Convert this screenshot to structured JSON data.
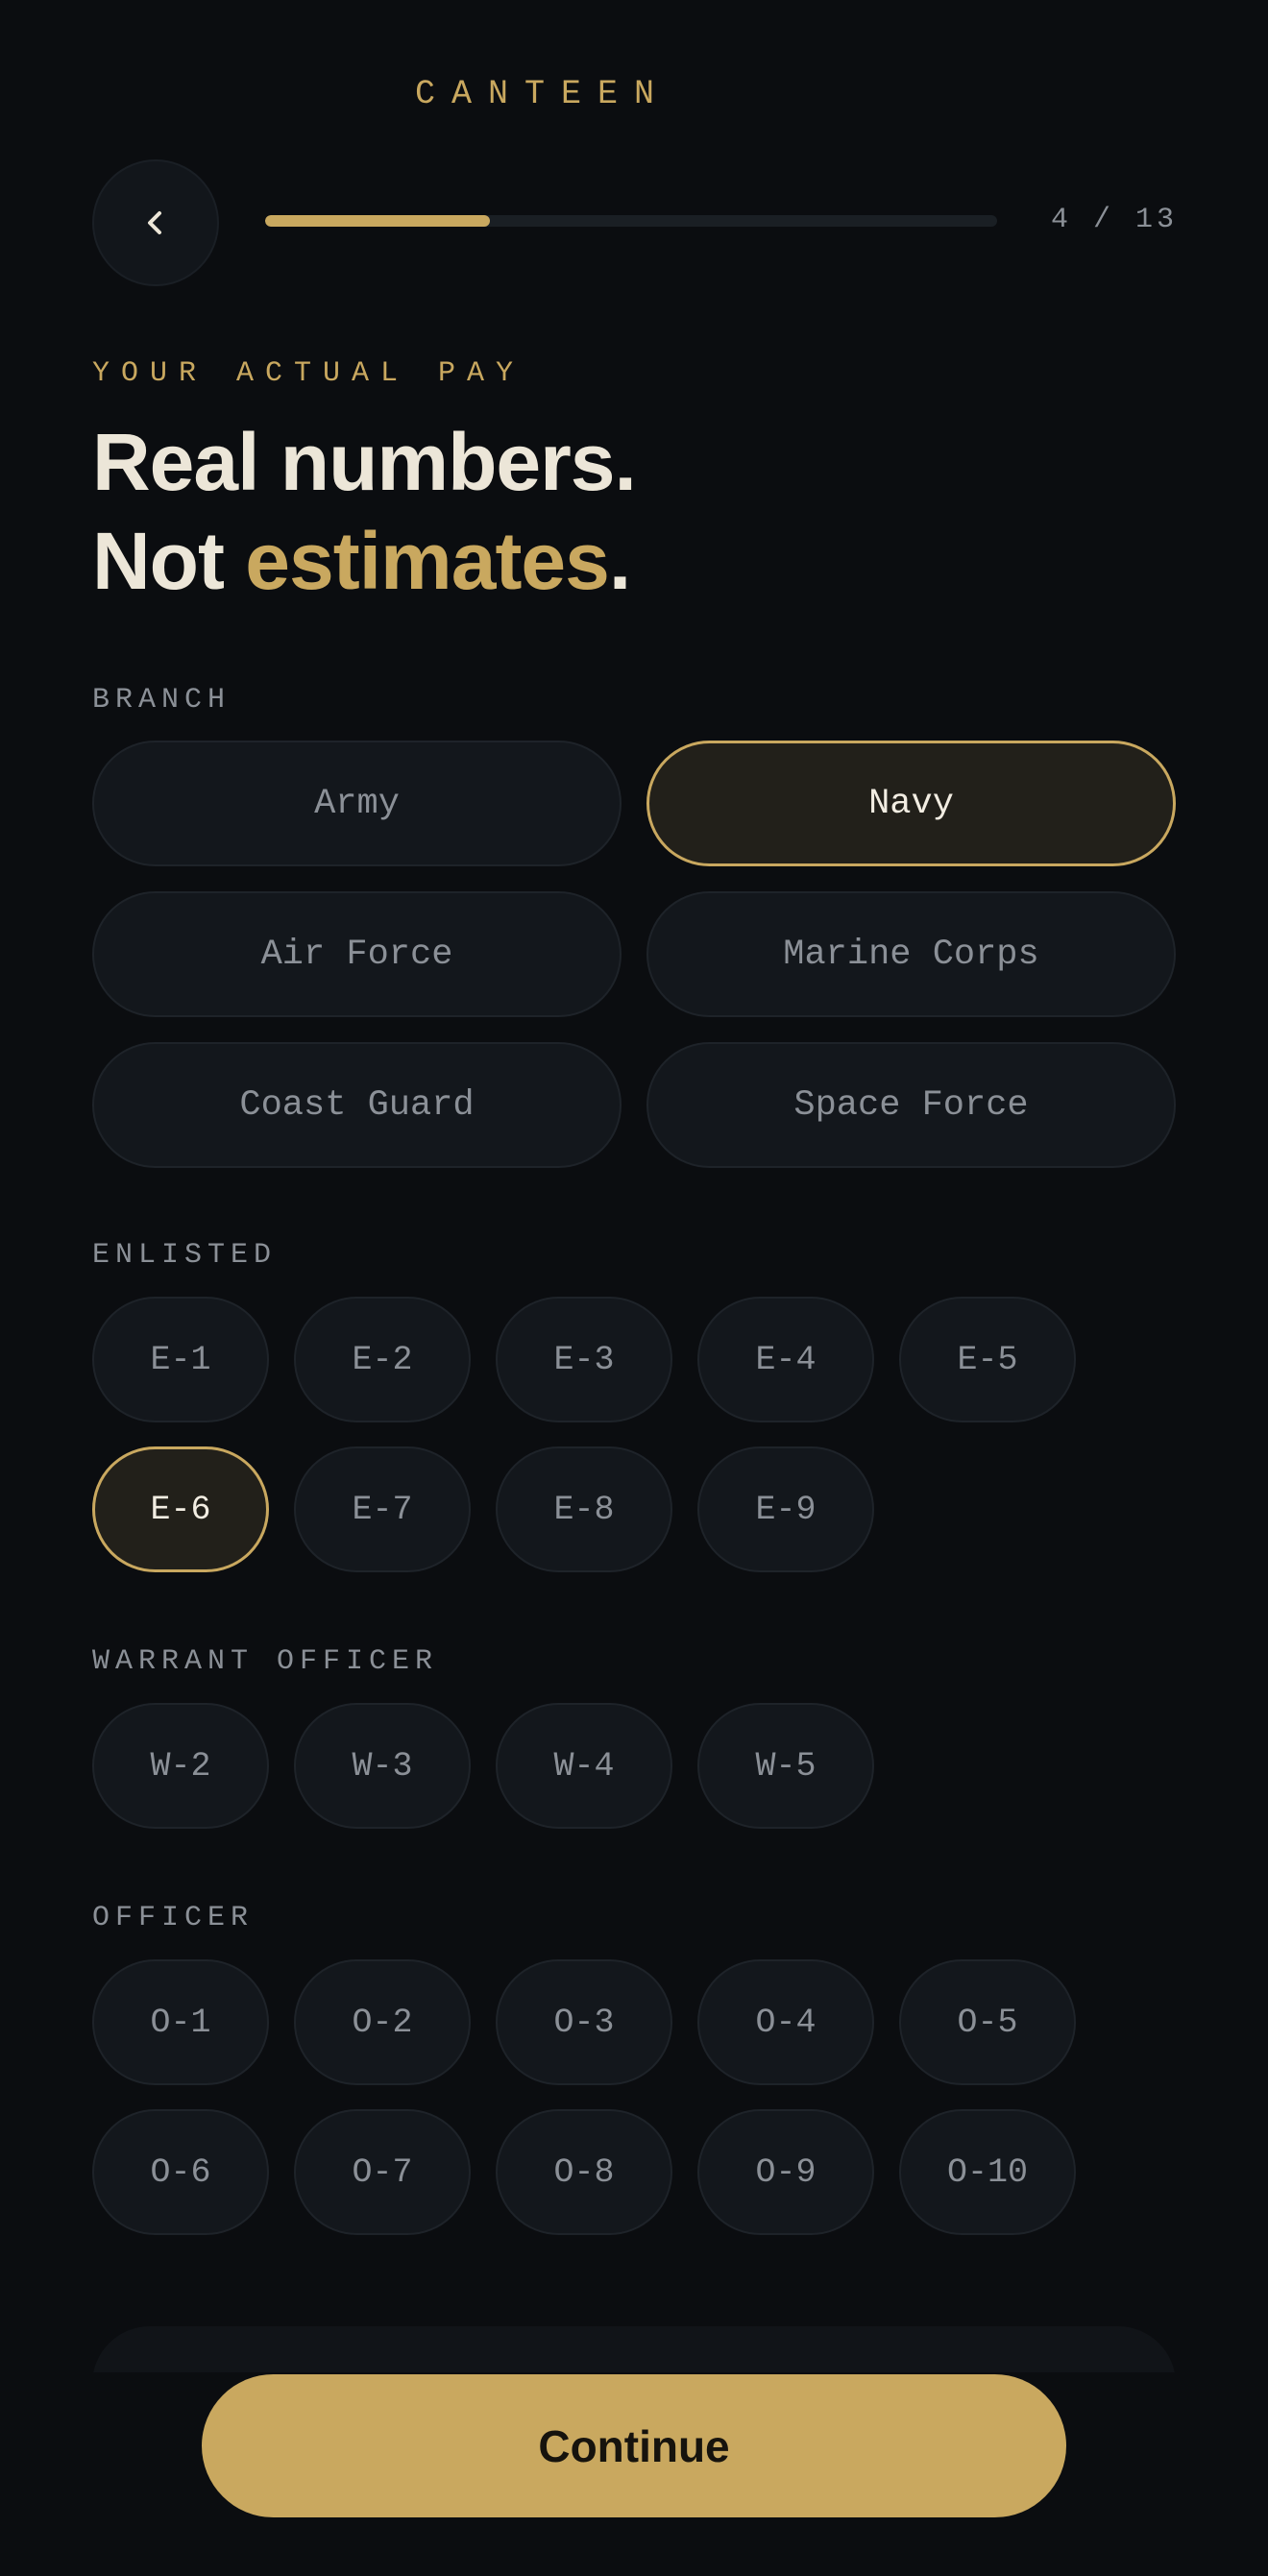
{
  "app": {
    "brand": "CANTEEN"
  },
  "nav": {
    "back_icon": "chevron-left-icon",
    "progress": {
      "current": 4,
      "total": 13,
      "label": "4 / 13",
      "fraction": 0.3077
    }
  },
  "intro": {
    "eyebrow": "YOUR ACTUAL PAY",
    "headline_line1": "Real numbers.",
    "headline_line2_prefix": "Not ",
    "headline_line2_accent": "estimates",
    "headline_line2_suffix": "."
  },
  "branch": {
    "label": "BRANCH",
    "selected": "Navy",
    "options": [
      "Army",
      "Navy",
      "Air Force",
      "Marine Corps",
      "Coast Guard",
      "Space Force"
    ]
  },
  "enlisted": {
    "label": "ENLISTED",
    "selected": "E-6",
    "row1": [
      "E-1",
      "E-2",
      "E-3",
      "E-4",
      "E-5"
    ],
    "row2": [
      "E-6",
      "E-7",
      "E-8",
      "E-9"
    ]
  },
  "warrant": {
    "label": "WARRANT OFFICER",
    "row1": [
      "W-2",
      "W-3",
      "W-4",
      "W-5"
    ]
  },
  "officer": {
    "label": "OFFICER",
    "row1": [
      "O-1",
      "O-2",
      "O-3",
      "O-4",
      "O-5"
    ],
    "row2": [
      "O-6",
      "O-7",
      "O-8",
      "O-9",
      "O-10"
    ]
  },
  "footer": {
    "continue_label": "Continue"
  },
  "colors": {
    "background": "#0b0d10",
    "accent": "#c9a85f",
    "pill_bg": "#13171c",
    "pill_text": "#8b9097",
    "selected_bg": "#22201a",
    "headline": "#ece6d8"
  }
}
